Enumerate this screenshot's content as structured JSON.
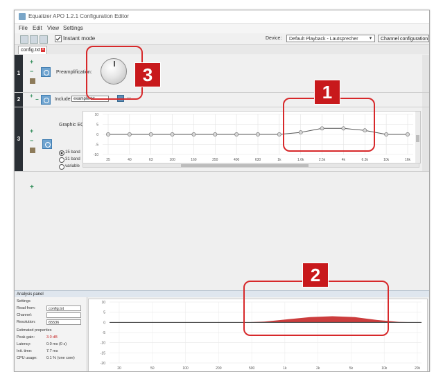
{
  "window": {
    "title": "Equalizer APO 1.2.1 Configuration Editor"
  },
  "menu": [
    "File",
    "Edit",
    "View",
    "Settings"
  ],
  "toolbar": {
    "instant_mode_label": "Instant mode",
    "instant_mode_checked": true,
    "device_label": "Device:",
    "device_value": "Default Playback - Lautsprecher",
    "channel_config_label": "Channel configuration"
  },
  "tab": {
    "label": "config.txt"
  },
  "rows": [
    {
      "number": "1",
      "label": "Preamplification:"
    },
    {
      "number": "2",
      "label": "Include:",
      "value": "example.txt"
    },
    {
      "number": "3",
      "label": "Graphic EQ:"
    }
  ],
  "graphic_eq": {
    "y_ticks": [
      "10",
      "5",
      "0",
      "-5",
      "-10"
    ],
    "band_options": [
      "15 band",
      "31 band",
      "variable"
    ],
    "selected_band": "15 band",
    "freq_labels": [
      "25",
      "40",
      "63",
      "100",
      "160",
      "250",
      "400",
      "630",
      "1k",
      "1.6k",
      "2.5k",
      "4k",
      "6.3k",
      "10k",
      "16k"
    ],
    "gains_db": [
      0,
      0,
      0,
      0,
      0,
      0,
      0,
      0,
      0,
      1,
      3,
      3,
      2,
      0,
      0
    ]
  },
  "analysis": {
    "header": "Analysis panel",
    "settings_label": "Settings",
    "read_from_label": "Read from:",
    "read_from_value": "config.txt",
    "channel_label": "Channel:",
    "resolution_label": "Resolution:",
    "resolution_value": "65536",
    "estimated_label": "Estimated properties",
    "peak_gain_label": "Peak gain:",
    "peak_gain_value": "3.0 dB",
    "latency_label": "Latency:",
    "latency_value": "0.0 ms (0 s)",
    "init_time_label": "Init. time:",
    "init_time_value": "7.7 ms",
    "cpu_usage_label": "CPU usage:",
    "cpu_usage_value": "0.1 % (one core)",
    "y_ticks": [
      "10",
      "5",
      "0",
      "-5",
      "-10",
      "-15",
      "-20"
    ],
    "x_labels": [
      "20",
      "50",
      "100",
      "200",
      "500",
      "1k",
      "2k",
      "5k",
      "10k",
      "20k"
    ],
    "curve_gains_db": [
      0,
      0,
      0,
      0,
      0,
      0,
      0,
      0.4,
      1.5,
      2.6,
      3.0,
      2.6,
      1.2,
      0.2,
      0
    ]
  },
  "callouts": [
    "1",
    "2",
    "3"
  ],
  "colors": {
    "callout": "#c8191c",
    "plot_line": "#555555",
    "response_fill": "#c62828"
  }
}
